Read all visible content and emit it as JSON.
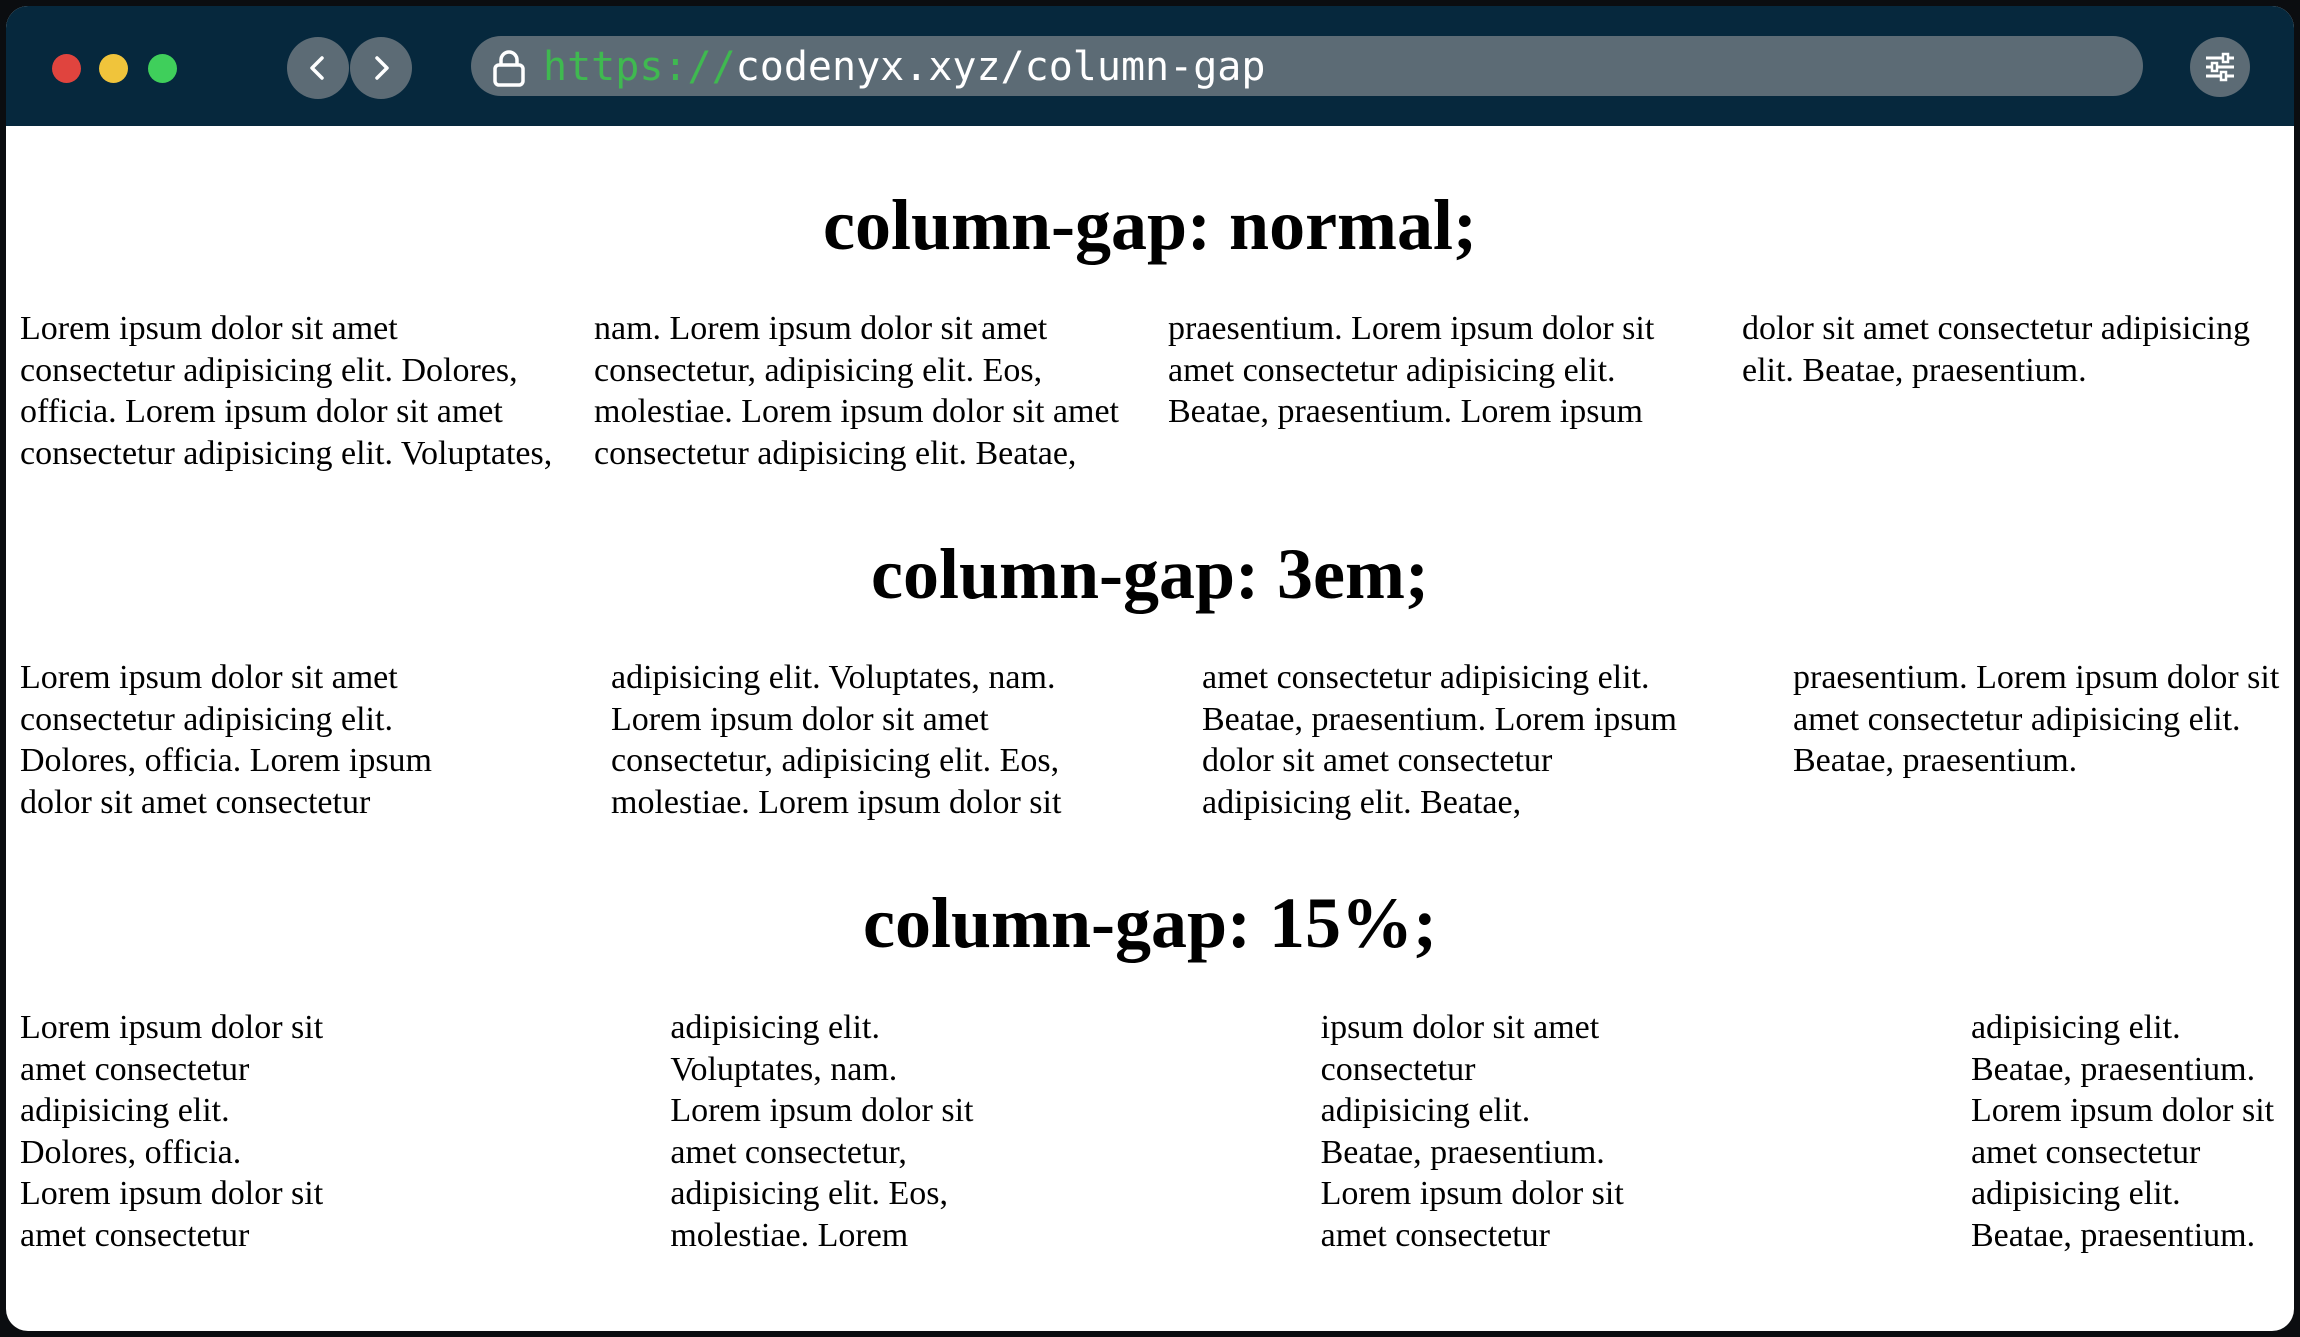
{
  "browser": {
    "url_protocol": "https://",
    "url_host": "codenyx.xyz/column-gap",
    "icons": [
      "back-chevron-icon",
      "forward-chevron-icon",
      "lock-icon",
      "sliders-icon"
    ]
  },
  "sections": [
    {
      "heading": "column-gap: normal;",
      "text": "Lorem ipsum dolor sit amet consectetur adipisicing elit. Dolores, officia. Lorem ipsum dolor sit amet consectetur adipisicing elit. Voluptates, nam. Lorem ipsum dolor sit amet consectetur, adipisicing elit. Eos, molestiae. Lorem ipsum dolor sit amet consectetur adipisicing elit. Beatae, praesentium. Lorem ipsum dolor sit amet consectetur adipisicing elit. Beatae, praesentium. Lorem ipsum dolor sit amet consectetur adipisicing elit. Beatae, praesentium."
    },
    {
      "heading": "column-gap: 3em;",
      "text": "Lorem ipsum dolor sit amet consectetur adipisicing elit. Dolores, officia. Lorem ipsum dolor sit amet consectetur adipisicing elit. Voluptates, nam. Lorem ipsum dolor sit amet consectetur, adipisicing elit. Eos, molestiae. Lorem ipsum dolor sit amet consectetur adipisicing elit. Beatae, praesentium. Lorem ipsum dolor sit amet consectetur adipisicing elit. Beatae, praesentium. Lorem ipsum dolor sit amet consectetur adipisicing elit. Beatae, praesentium."
    },
    {
      "heading": "column-gap: 15%;",
      "text": "Lorem ipsum dolor sit amet consectetur adipisicing elit. Dolores, officia. Lorem ipsum dolor sit amet consectetur adipisicing elit. Voluptates, nam. Lorem ipsum dolor sit amet consectetur, adipisicing elit. Eos, molestiae. Lorem ipsum dolor sit amet consectetur adipisicing elit. Beatae, praesentium. Lorem ipsum dolor sit amet consectetur adipisicing elit. Beatae, praesentium. Lorem ipsum dolor sit amet consectetur adipisicing elit. Beatae, praesentium."
    }
  ],
  "colors": {
    "titlebar": "#06283d",
    "control": "#5c6b75",
    "protocol": "#3fb950"
  }
}
